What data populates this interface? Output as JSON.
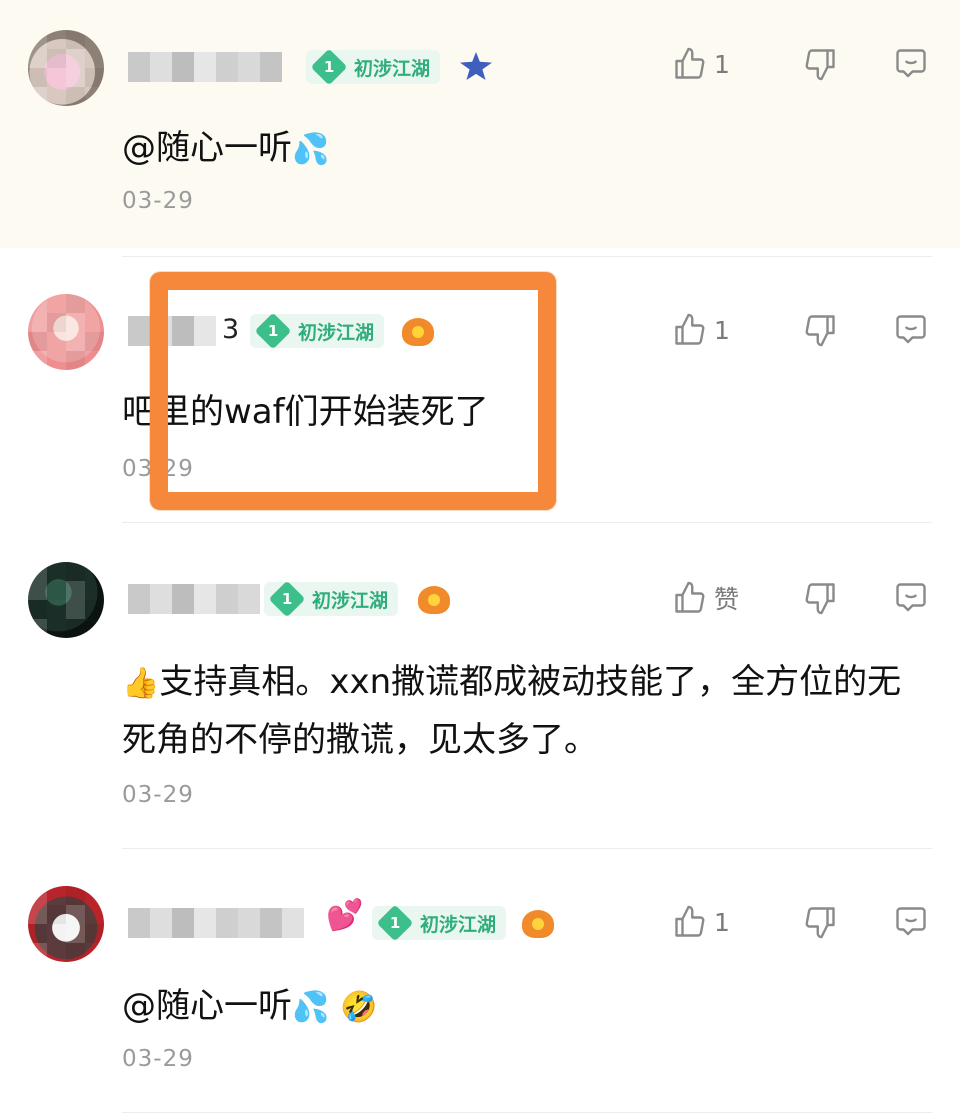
{
  "comments": [
    {
      "badge_level": "1",
      "badge_text": "初涉江湖",
      "badge_deco": "star-medal-icon",
      "text": "@随心一听",
      "emoji": "💦",
      "date": "03-29",
      "like_count": "1"
    },
    {
      "name_tail": "3",
      "badge_level": "1",
      "badge_text": "初涉江湖",
      "badge_deco": "crown-icon",
      "text": "吧里的waf们开始装死了",
      "date": "03-29",
      "like_count": "1"
    },
    {
      "badge_level": "1",
      "badge_text": "初涉江湖",
      "badge_deco": "crown-icon",
      "emoji": "👍",
      "text": "支持真相。xxn撒谎都成被动技能了，全方位的无死角的不停的撒谎，见太多了。",
      "date": "03-29",
      "like_label": "赞"
    },
    {
      "badge_level": "1",
      "badge_text": "初涉江湖",
      "badge_deco": "crown-icon",
      "name_emoji": "💕",
      "text": "@随心一听",
      "emoji": "💦",
      "emoji2": "🤣",
      "date": "03-29",
      "like_count": "1"
    }
  ],
  "colors": {
    "badge_green": "#2fae7c",
    "highlight_orange": "#f5883a",
    "date_gray": "#9a9a9a",
    "first_comment_bg": "#fdfbf1"
  },
  "icons": [
    "thumbs-up-icon",
    "thumbs-down-icon",
    "reply-bubble-icon"
  ]
}
